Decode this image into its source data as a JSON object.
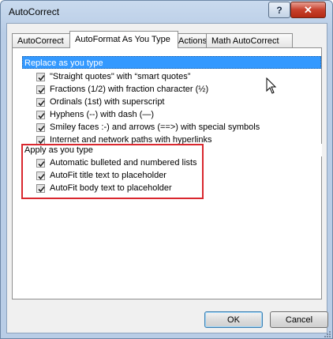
{
  "window": {
    "title": "AutoCorrect",
    "help_label": "?",
    "close_label": "✕"
  },
  "tabs": [
    {
      "label": "AutoCorrect"
    },
    {
      "label": "AutoFormat As You Type"
    },
    {
      "label": "Actions"
    },
    {
      "label": "Math AutoCorrect"
    }
  ],
  "replace_group": {
    "header": "Replace as you type",
    "items": [
      {
        "label": "\"Straight quotes\" with “smart quotes”",
        "checked": true
      },
      {
        "label": "Fractions (1/2) with fraction character (½)",
        "checked": true
      },
      {
        "label": "Ordinals (1st) with superscript",
        "checked": true
      },
      {
        "label": "Hyphens (--) with dash (—)",
        "checked": true
      },
      {
        "label": "Smiley faces :-) and arrows (==>) with special symbols",
        "checked": true
      },
      {
        "label": "Internet and network paths with hyperlinks",
        "checked": true
      }
    ]
  },
  "apply_group": {
    "header": "Apply as you type",
    "items": [
      {
        "label": "Automatic bulleted and numbered lists",
        "checked": true
      },
      {
        "label": "AutoFit title text to placeholder",
        "checked": true
      },
      {
        "label": "AutoFit body text to placeholder",
        "checked": true
      }
    ]
  },
  "buttons": {
    "ok": "OK",
    "cancel": "Cancel"
  },
  "colors": {
    "selection": "#3399ff",
    "highlight_box": "#d9272e"
  }
}
